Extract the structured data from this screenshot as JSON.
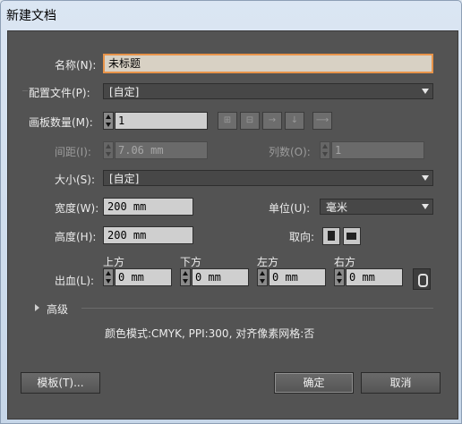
{
  "window": {
    "title": "新建文档"
  },
  "name_row": {
    "label": "名称(N):",
    "value": "未标题"
  },
  "profile": {
    "label": "配置文件(P):",
    "value": "[自定]"
  },
  "artboards": {
    "label": "画板数量(M):",
    "value": "1"
  },
  "spacing": {
    "label": "间距(I):",
    "value": "7.06 mm"
  },
  "columns": {
    "label": "列数(O):",
    "value": "1"
  },
  "size": {
    "label": "大小(S):",
    "value": "[自定]"
  },
  "width": {
    "label": "宽度(W):",
    "value": "200 mm"
  },
  "units": {
    "label": "单位(U):",
    "value": "毫米"
  },
  "height": {
    "label": "高度(H):",
    "value": "200 mm"
  },
  "orientation": {
    "label": "取向:"
  },
  "bleed": {
    "label": "出血(L):",
    "top": {
      "label": "上方",
      "value": "0 mm"
    },
    "bottom": {
      "label": "下方",
      "value": "0 mm"
    },
    "left": {
      "label": "左方",
      "value": "0 mm"
    },
    "right": {
      "label": "右方",
      "value": "0 mm"
    }
  },
  "advanced": {
    "label": "高级"
  },
  "summary": "颜色模式:CMYK, PPI:300, 对齐像素网格:否",
  "buttons": {
    "templates": "模板(T)...",
    "ok": "确定",
    "cancel": "取消"
  },
  "icons": {
    "layout": [
      "grid-by-row-icon",
      "grid-by-column-icon",
      "arrange-by-row-icon",
      "arrange-by-column-icon",
      "right-to-left-icon"
    ],
    "portrait": "portrait-icon",
    "landscape": "landscape-icon",
    "link": "link-icon",
    "dropdown": "chevron-down-icon",
    "disclosure": "triangle-right-icon"
  },
  "colors": {
    "panel": "#535353",
    "focus": "#e8944a"
  }
}
